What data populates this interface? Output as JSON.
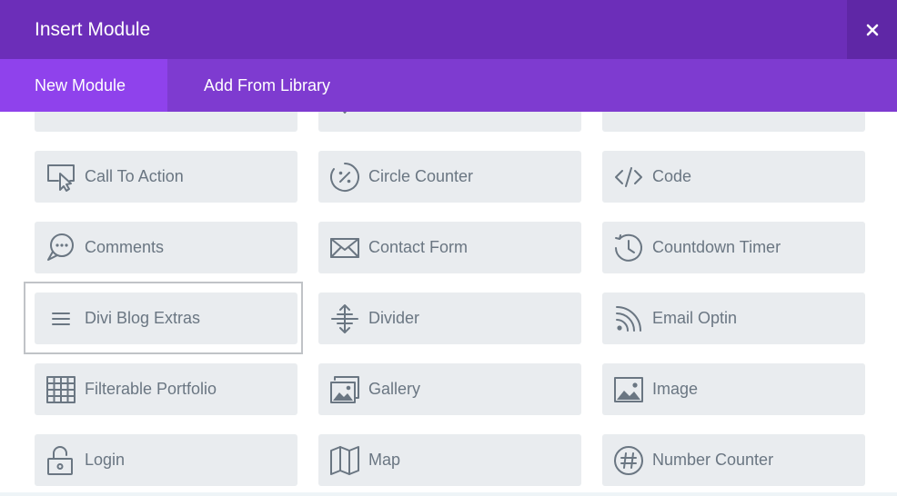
{
  "dialog": {
    "title": "Insert Module",
    "close_glyph": "✕"
  },
  "tabs": [
    {
      "label": "New Module",
      "active": true
    },
    {
      "label": "Add From Library",
      "active": false
    }
  ],
  "modules": [
    {
      "label": "",
      "icon": "image-icon-partial"
    },
    {
      "label": "",
      "icon": "chat-icon-partial"
    },
    {
      "label": "",
      "icon": "lines-icon-partial"
    },
    {
      "label": "Call To Action",
      "icon": "cursor-click-icon"
    },
    {
      "label": "Circle Counter",
      "icon": "circle-percent-icon"
    },
    {
      "label": "Code",
      "icon": "code-icon"
    },
    {
      "label": "Comments",
      "icon": "comments-icon"
    },
    {
      "label": "Contact Form",
      "icon": "envelope-icon"
    },
    {
      "label": "Countdown Timer",
      "icon": "clock-history-icon"
    },
    {
      "label": "Divi Blog Extras",
      "icon": "hamburger-menu-icon"
    },
    {
      "label": "Divider",
      "icon": "divider-arrows-icon"
    },
    {
      "label": "Email Optin",
      "icon": "rss-icon"
    },
    {
      "label": "Filterable Portfolio",
      "icon": "grid-table-icon"
    },
    {
      "label": "Gallery",
      "icon": "gallery-icon"
    },
    {
      "label": "Image",
      "icon": "image-icon"
    },
    {
      "label": "Login",
      "icon": "padlock-icon"
    },
    {
      "label": "Map",
      "icon": "map-icon"
    },
    {
      "label": "Number Counter",
      "icon": "hash-circle-icon"
    }
  ],
  "colors": {
    "title_bar": "#6c2eb9",
    "tab_bar": "#7e3bd0",
    "active_tab": "#8f42ec",
    "module_bg": "#e9ecef",
    "module_text": "#6a7682"
  }
}
